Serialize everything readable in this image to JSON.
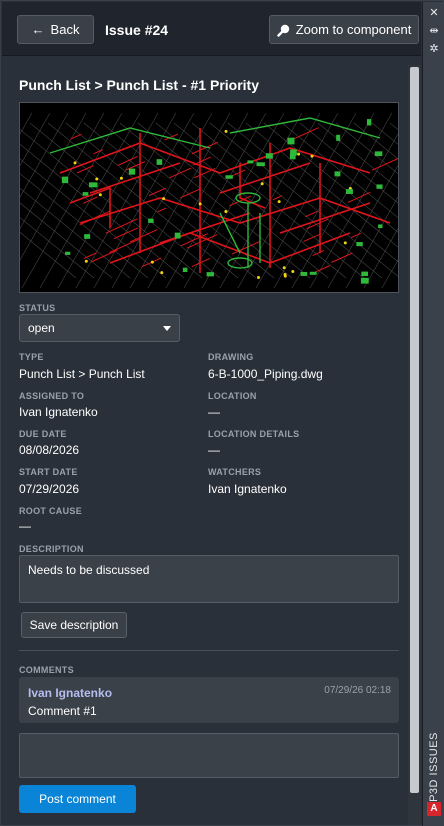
{
  "header": {
    "back_label": "Back",
    "back_arrow": "←",
    "issue_title": "Issue #24",
    "zoom_label": "Zoom to component"
  },
  "side_panel": {
    "label": "P3D ISSUES",
    "logo_letter": "A"
  },
  "breadcrumb": "Punch List > Punch List - #1 Priority",
  "fields": {
    "status_label": "STATUS",
    "status_value": "open",
    "type_label": "TYPE",
    "type_value": "Punch List > Punch List",
    "drawing_label": "DRAWING",
    "drawing_value": "6-B-1000_Piping.dwg",
    "assigned_label": "ASSIGNED TO",
    "assigned_value": "Ivan Ignatenko",
    "location_label": "LOCATION",
    "location_value": "—",
    "due_label": "DUE DATE",
    "due_value": "08/08/2026",
    "location_details_label": "LOCATION DETAILS",
    "location_details_value": "—",
    "start_label": "START DATE",
    "start_value": "07/29/2026",
    "watchers_label": "WATCHERS",
    "watchers_value": "Ivan Ignatenko",
    "root_cause_label": "ROOT CAUSE",
    "root_cause_value": "—"
  },
  "description": {
    "label": "DESCRIPTION",
    "value": "Needs to be discussed",
    "save_label": "Save description"
  },
  "comments": {
    "label": "COMMENTS",
    "items": [
      {
        "author": "Ivan Ignatenko",
        "time": "07/29/26 02:18",
        "text": "Comment #1"
      }
    ],
    "input_placeholder": "",
    "post_label": "Post comment"
  },
  "colors": {
    "accent_blue": "#0a84d6",
    "pipe_red": "#e0151b",
    "pipe_green": "#2fb93a",
    "pipe_yellow": "#f2d40c"
  }
}
